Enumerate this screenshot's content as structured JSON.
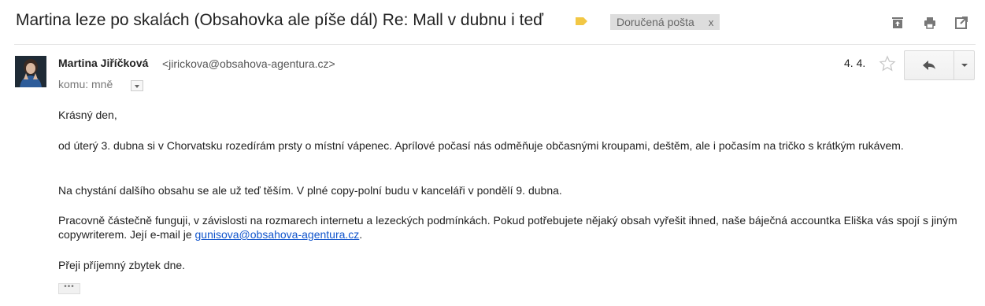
{
  "subject": {
    "title": "Martina leze po skalách (Obsahovka ale píše dál) Re: Mall v dubnu i teď",
    "label_chip": "Doručená pošta",
    "label_chip_close": "x",
    "colors": {
      "important_tag": "#f2c744",
      "chip_bg": "#dddddd"
    }
  },
  "toolbar": {
    "icons": [
      "archive-icon",
      "print-icon",
      "open-new-window-icon"
    ]
  },
  "message": {
    "sender_name": "Martina Jiříčková",
    "sender_email": "<jirickova@obsahova-agentura.cz>",
    "to_line": "komu: mně",
    "date": "4. 4.",
    "paragraphs": {
      "greeting": "Krásný den,",
      "p1": "od úterý 3. dubna si v Chorvatsku rozedírám prsty o místní vápenec. Aprílové počasí nás odměňuje občasnými kroupami, deštěm, ale i počasím na tričko s krátkým rukávem.",
      "p2": "Na chystání dalšího obsahu se ale už teď těším. V plné copy-polní budu v kanceláři v pondělí 9. dubna.",
      "p3_part1": "Pracovně částečně funguji, v závislosti na rozmarech internetu a lezeckých podmínkách. Pokud potřebujete nějaký obsah vyřešit ihned, naše báječná accountka Eliška vás spojí s jiným copywriterem. Její e-mail je ",
      "p3_link": "gunisova@obsahova-agentura.cz",
      "p3_end": ".",
      "closing": "Přeji příjemný zbytek dne."
    },
    "show_trimmed": "•••"
  }
}
